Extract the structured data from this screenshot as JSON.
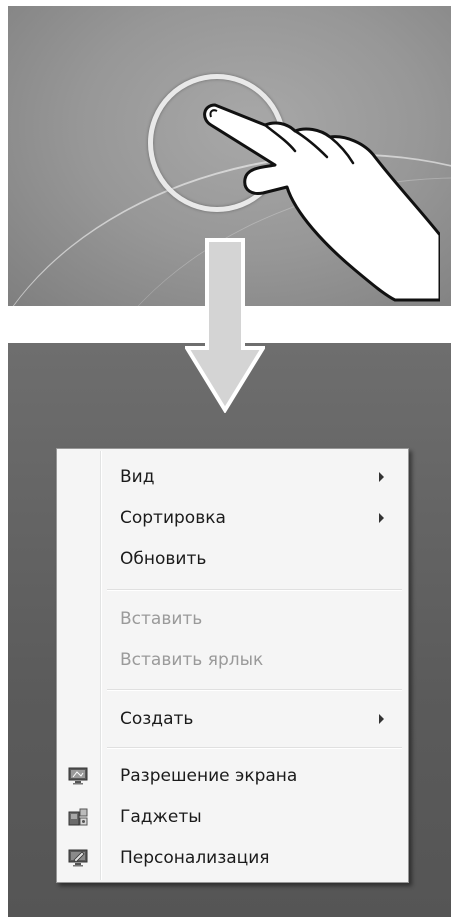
{
  "gesture": {
    "description_icons": [
      "touch-ring-icon",
      "hand-pointer-icon",
      "down-arrow-icon"
    ]
  },
  "context_menu": {
    "items": [
      {
        "label": "Вид",
        "submenu": true,
        "disabled": false
      },
      {
        "label": "Сортировка",
        "submenu": true,
        "disabled": false
      },
      {
        "label": "Обновить",
        "submenu": false,
        "disabled": false
      },
      {
        "label": "Вставить",
        "submenu": false,
        "disabled": true
      },
      {
        "label": "Вставить ярлык",
        "submenu": false,
        "disabled": true
      },
      {
        "label": "Создать",
        "submenu": true,
        "disabled": false
      },
      {
        "label": "Разрешение экрана",
        "submenu": false,
        "disabled": false,
        "icon": "screen-resolution-icon"
      },
      {
        "label": "Гаджеты",
        "submenu": false,
        "disabled": false,
        "icon": "gadgets-icon"
      },
      {
        "label": "Персонализация",
        "submenu": false,
        "disabled": false,
        "icon": "personalization-icon"
      }
    ]
  },
  "colors": {
    "menu_background": "#f5f5f5",
    "menu_text": "#1b1b1b",
    "menu_disabled_text": "#9a9a9a",
    "desktop_top": "#979797",
    "desktop_bottom": "#5b5b5b"
  }
}
